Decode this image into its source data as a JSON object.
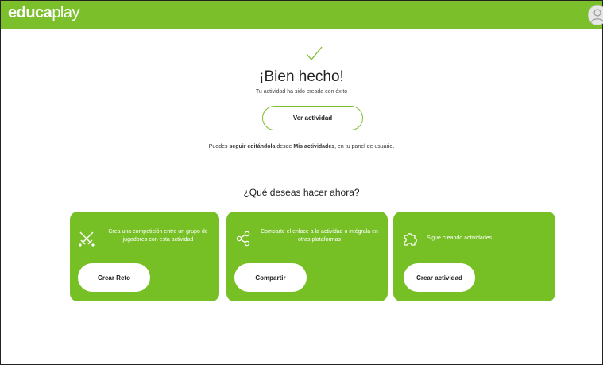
{
  "header": {
    "logo_bold": "educa",
    "logo_light": "play",
    "colors": {
      "brand": "#7bbf2a",
      "card": "#76bf25"
    }
  },
  "success": {
    "icon": "checkmark-icon",
    "title": "¡Bien hecho!",
    "subtitle": "Tu actividad ha sido creada con éxito",
    "view_button": "Ver actividad"
  },
  "info": {
    "prefix": "Puedes ",
    "link_edit": "seguir editándola",
    "middle": " desde ",
    "link_activities": "Mis actividades",
    "suffix": ", en tu panel de usuario."
  },
  "next": {
    "question": "¿Qué deseas hacer ahora?",
    "cards": [
      {
        "icon": "crossed-swords-icon",
        "text": "Crea una competición entre un grupo de jugadores con esta actividad",
        "button": "Crear Reto"
      },
      {
        "icon": "share-icon",
        "text": "Comparte el enlace a la actividad o intégrala en otras plataformas",
        "button": "Compartir"
      },
      {
        "icon": "puzzle-icon",
        "text": "Sigue creando actividades",
        "button": "Crear actividad"
      }
    ]
  }
}
